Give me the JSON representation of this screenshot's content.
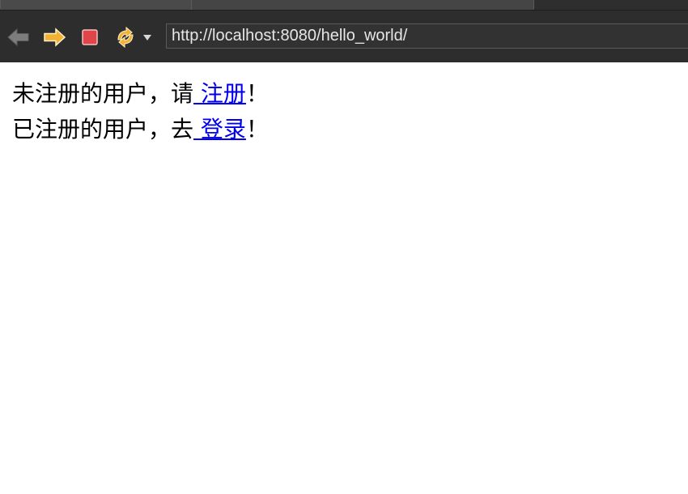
{
  "browser": {
    "url": "http://localhost:8080/hello_world/",
    "icons": {
      "back": "arrow-left-icon",
      "forward": "arrow-right-icon",
      "stop": "stop-icon",
      "refresh": "refresh-icon",
      "dropdown": "chevron-down-icon"
    },
    "colors": {
      "toolbar_bg": "#2d2d2d",
      "forward_arrow": "#f2b134",
      "stop_red": "#e0454a",
      "refresh_yellow": "#f2b134"
    }
  },
  "page": {
    "lines": [
      {
        "prefix": "未注册的用户，请",
        "link_text": " 注册",
        "suffix": "！"
      },
      {
        "prefix": "已注册的用户，去",
        "link_text": " 登录",
        "suffix": "！"
      }
    ],
    "link_color": "#0000ee"
  }
}
